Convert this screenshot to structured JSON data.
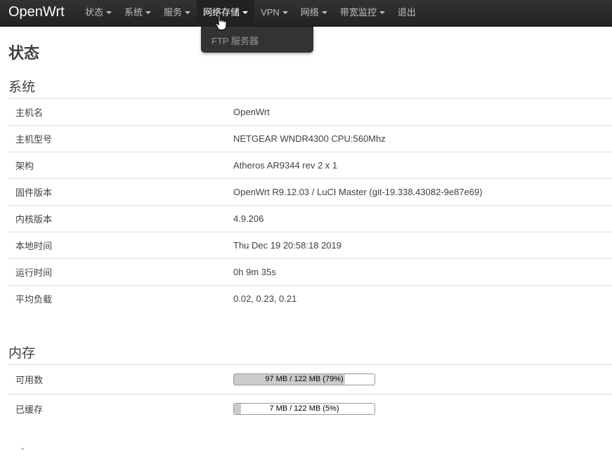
{
  "navbar": {
    "brand": "OpenWrt",
    "menu": [
      {
        "label": "状态",
        "dropdown": true
      },
      {
        "label": "系统",
        "dropdown": true
      },
      {
        "label": "服务",
        "dropdown": true
      },
      {
        "label": "网络存储",
        "dropdown": true,
        "active": true
      },
      {
        "label": "VPN",
        "dropdown": true
      },
      {
        "label": "网络",
        "dropdown": true
      },
      {
        "label": "带宽监控",
        "dropdown": true
      },
      {
        "label": "退出",
        "dropdown": false
      }
    ],
    "open_dropdown": {
      "items": [
        "FTP 服务器"
      ]
    }
  },
  "page": {
    "title": "状态"
  },
  "system": {
    "title": "系统",
    "rows": [
      {
        "key": "主机名",
        "value": "OpenWrt"
      },
      {
        "key": "主机型号",
        "value": "NETGEAR WNDR4300 CPU:560Mhz"
      },
      {
        "key": "架构",
        "value": "Atheros AR9344 rev 2 x 1"
      },
      {
        "key": "固件版本",
        "value": "OpenWrt R9.12.03 / LuCI Master (git-19.338.43082-9e87e69)"
      },
      {
        "key": "内核版本",
        "value": "4.9.206"
      },
      {
        "key": "本地时间",
        "value": "Thu Dec 19 20:58:18 2019"
      },
      {
        "key": "运行时间",
        "value": "0h 9m 35s"
      },
      {
        "key": "平均负载",
        "value": "0.02, 0.23, 0.21"
      }
    ]
  },
  "memory": {
    "title": "内存",
    "rows": [
      {
        "key": "可用数",
        "value": "97 MB / 122 MB (79%)",
        "percent": 79
      },
      {
        "key": "已缓存",
        "value": "7 MB / 122 MB (5%)",
        "percent": 5
      }
    ]
  },
  "colors": {
    "navbar_bg": "#222222",
    "bar_fill": "#cccccc",
    "row_border": "#dddddd"
  }
}
